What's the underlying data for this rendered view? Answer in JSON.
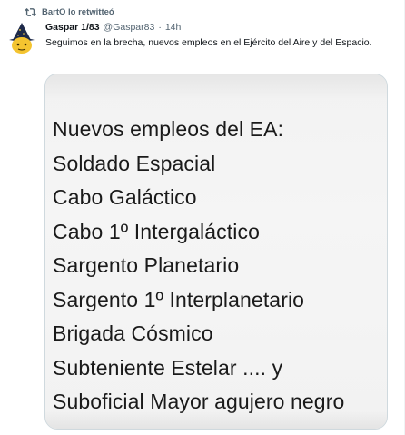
{
  "retweet": {
    "label": "BartO lo retwitteó",
    "icon": "retweet-icon"
  },
  "author": {
    "display_name": "Gaspar 1/83",
    "handle": "@Gaspar83",
    "separator": "·",
    "time": "14h",
    "avatar_icon": "wizard-avatar"
  },
  "tweet": {
    "text": "Seguimos en la brecha, nuevos empleos en el Ejército del Aire y del Espacio."
  },
  "media": {
    "lines": [
      "Nuevos empleos del EA:",
      "Soldado Espacial",
      "Cabo Galáctico",
      "Cabo 1º Intergaláctico",
      "Sargento Planetario",
      "Sargento 1º Interplanetario",
      "Brigada Cósmico",
      "Subteniente Estelar .... y",
      "Suboficial Mayor agujero negro"
    ]
  },
  "colors": {
    "text_primary": "#0f1419",
    "text_secondary": "#536471",
    "border": "#cfd9de"
  }
}
